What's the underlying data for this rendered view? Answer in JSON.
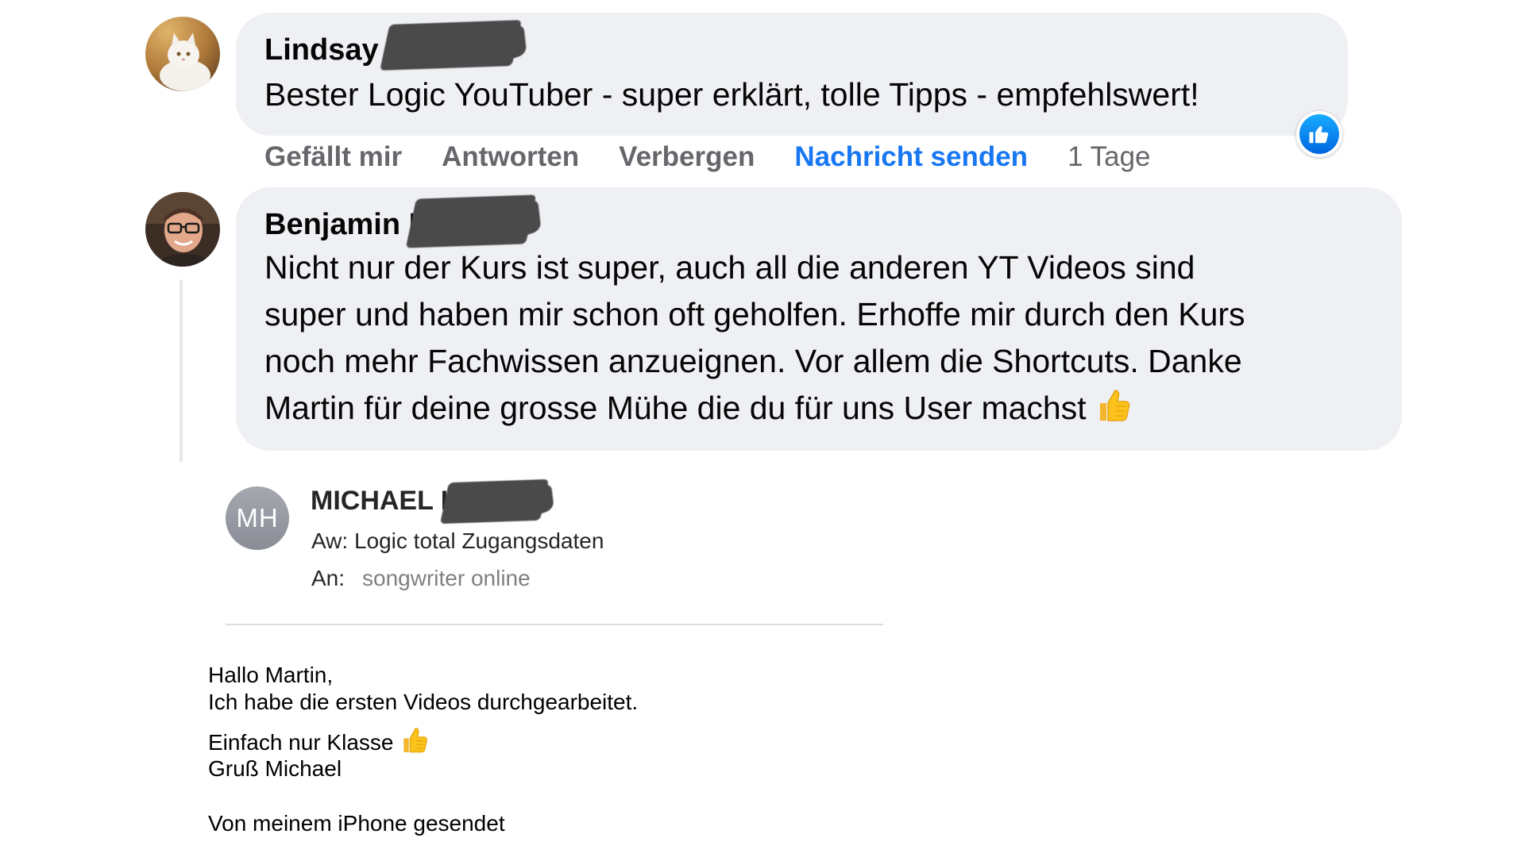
{
  "comments": [
    {
      "author": "Lindsay W",
      "text": "Bester Logic YouTuber - super erklärt, tolle Tipps - empfehlswert!",
      "actions": {
        "like": "Gefällt mir",
        "reply": "Antworten",
        "hide": "Verbergen",
        "message": "Nachricht senden",
        "time": "1 Tage"
      }
    },
    {
      "author": "Benjamin E",
      "text_lines": [
        "Nicht nur der Kurs ist super, auch all die anderen YT Videos sind",
        "super und haben mir schon oft geholfen. Erhoffe mir durch den Kurs",
        "noch mehr Fachwissen anzueignen. Vor allem die Shortcuts. Danke",
        "Martin für deine grosse Mühe die du für uns User machst"
      ]
    }
  ],
  "mail": {
    "avatar_initials": "MH",
    "sender": "MICHAEL H",
    "subject": "Aw: Logic total Zugangsdaten",
    "to_label": "An:",
    "to_value": "songwriter online",
    "body": {
      "greeting": "Hallo Martin,",
      "line1": "Ich habe die ersten Videos durchgearbeitet.",
      "line2": "Einfach nur Klasse",
      "signoff": "Gruß Michael",
      "footer": "Von meinem iPhone gesendet"
    }
  },
  "colors": {
    "bubble": "#eef0f3",
    "link_blue": "#1877f2",
    "muted_gray": "#65676b",
    "like_blue": "#0165e1"
  },
  "icons": [
    "cat-avatar",
    "man-avatar",
    "like-reaction-icon",
    "thumbs-up-emoji"
  ]
}
